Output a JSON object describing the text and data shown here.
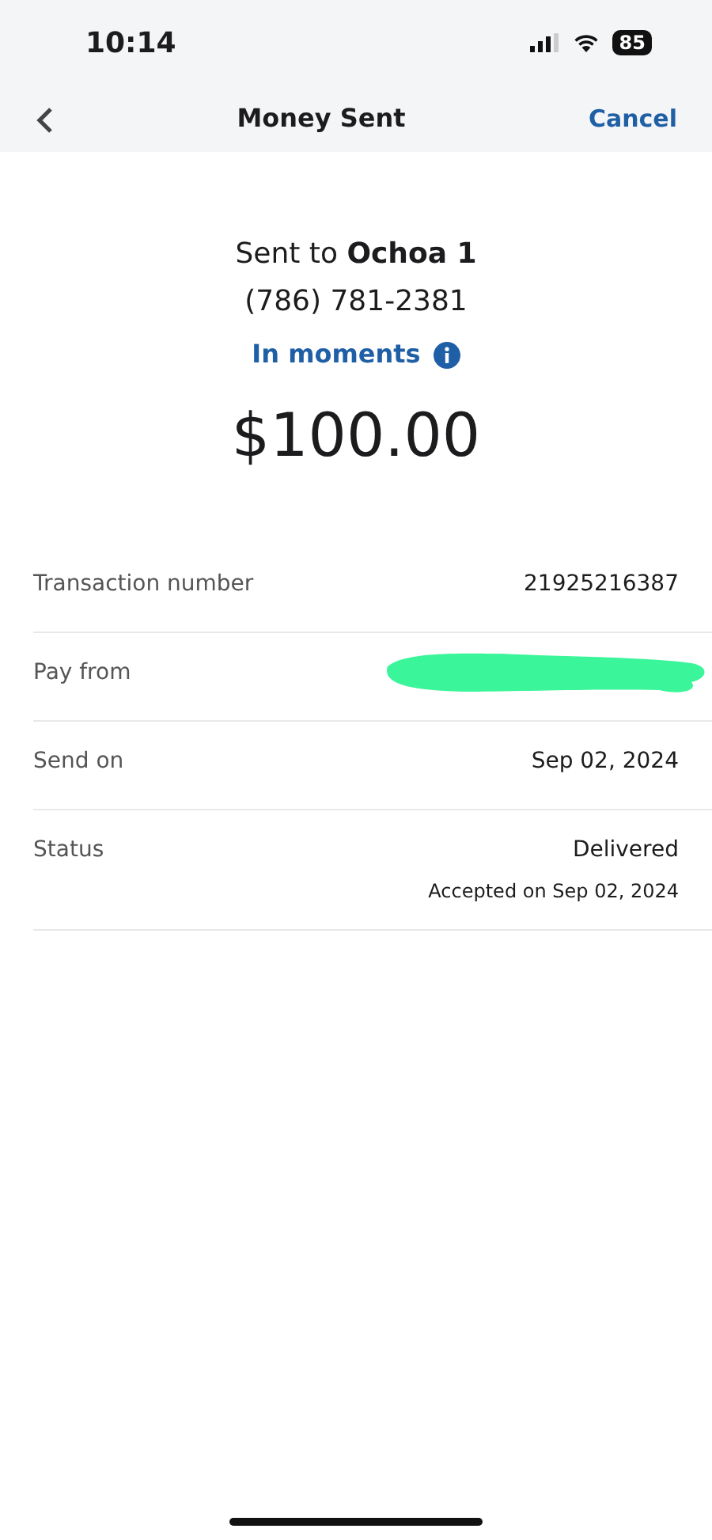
{
  "status_bar": {
    "time": "10:14",
    "battery": "85"
  },
  "nav": {
    "title": "Money Sent",
    "action": "Cancel"
  },
  "summary": {
    "recipient": "Sent to **Ochoa 1**",
    "phone": "(786) 781-2381",
    "timing": "In moments",
    "amount": "$100.00"
  },
  "details": [
    {
      "label": "Transaction number",
      "value": "21925216387"
    },
    {
      "label": "Pay from",
      "redacted": true
    },
    {
      "label": "Send on",
      "value": "Sep 02, 2024"
    },
    {
      "label": "Status",
      "value": "Delivered",
      "note": "Accepted on Sep 02, 2024"
    }
  ]
}
